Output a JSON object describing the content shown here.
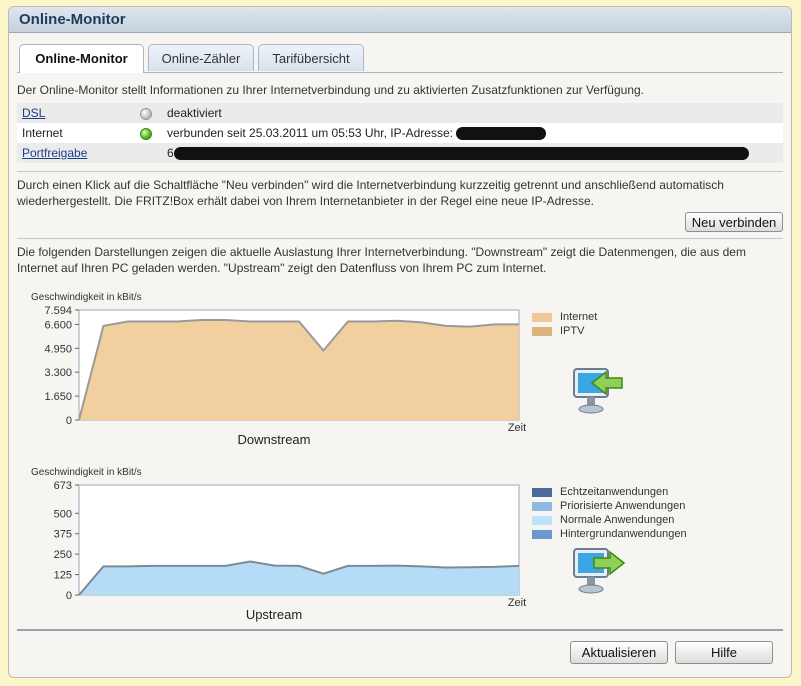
{
  "window": {
    "title": "Online-Monitor"
  },
  "tabs": [
    {
      "label": "Online-Monitor",
      "active": true
    },
    {
      "label": "Online-Zähler",
      "active": false
    },
    {
      "label": "Tarifübersicht",
      "active": false
    }
  ],
  "intro": "Der Online-Monitor stellt Informationen zu Ihrer Internetverbindung und zu aktivierten Zusatzfunktionen zur Verfügung.",
  "status_rows": [
    {
      "label": "DSL",
      "link": true,
      "led": "grey",
      "value": "deaktiviert"
    },
    {
      "label": "Internet",
      "link": false,
      "led": "green",
      "value": "verbunden seit 25.03.2011 um 05:53 Uhr, IP-Adresse:"
    },
    {
      "label": "Portfreigabe",
      "link": true,
      "led": "none",
      "value": "6"
    }
  ],
  "reconnect": {
    "text": "Durch einen Klick auf die Schaltfläche \"Neu verbinden\" wird die Internetverbindung kurzzeitig getrennt und anschließend automatisch wiederhergestellt. Die FRITZ!Box erhält dabei von Ihrem Internetanbieter in der Regel eine neue IP-Adresse.",
    "button": "Neu verbinden"
  },
  "charts_intro": "Die folgenden Darstellungen zeigen die aktuelle Auslastung Ihrer Internetverbindung. \"Downstream\" zeigt die Datenmengen, die aus dem Internet auf Ihren PC geladen werden. \"Upstream\" zeigt den Datenfluss von Ihrem PC zum Internet.",
  "colors": {
    "internet": "#f2c89a",
    "iptv": "#ddb27e",
    "down_fill": "#f1cf9f",
    "up_fill": "#b5dcf6",
    "echtzeit": "#4b6a9b",
    "priorisiert": "#8fb8e2",
    "normal": "#bde3fa",
    "hintergrund": "#6a98cf"
  },
  "chart_data": [
    {
      "type": "area",
      "title": "Downstream",
      "ylabel": "Geschwindigkeit in kBit/s",
      "xlabel": "Zeit",
      "yticks": [
        "7.594",
        "6.600",
        "4.950",
        "3.300",
        "1.650",
        "0"
      ],
      "ytick_values": [
        7594,
        6600,
        4950,
        3300,
        1650,
        0
      ],
      "ylim": [
        0,
        7594
      ],
      "series": [
        {
          "name": "Internet",
          "values": [
            0,
            6500,
            6800,
            6800,
            6800,
            6900,
            6900,
            6800,
            6800,
            6800,
            4800,
            6800,
            6800,
            6850,
            6750,
            6500,
            6450,
            6600,
            6600
          ]
        },
        {
          "name": "IPTV",
          "values": []
        }
      ],
      "legend": [
        "Internet",
        "IPTV"
      ]
    },
    {
      "type": "area",
      "title": "Upstream",
      "ylabel": "Geschwindigkeit in kBit/s",
      "xlabel": "Zeit",
      "yticks": [
        "673",
        "500",
        "375",
        "250",
        "125",
        "0"
      ],
      "ytick_values": [
        673,
        500,
        375,
        250,
        125,
        0
      ],
      "ylim": [
        0,
        673
      ],
      "series": [
        {
          "name": "Normale Anwendungen",
          "values": [
            0,
            175,
            175,
            178,
            178,
            178,
            178,
            205,
            180,
            178,
            130,
            178,
            178,
            180,
            175,
            168,
            170,
            172,
            178
          ]
        },
        {
          "name": "Echtzeitanwendungen",
          "values": []
        },
        {
          "name": "Priorisierte Anwendungen",
          "values": []
        },
        {
          "name": "Hintergrundanwendungen",
          "values": []
        }
      ],
      "legend": [
        "Echtzeitanwendungen",
        "Priorisierte Anwendungen",
        "Normale Anwendungen",
        "Hintergrundanwendungen"
      ]
    }
  ],
  "footer": {
    "refresh": "Aktualisieren",
    "help": "Hilfe"
  }
}
